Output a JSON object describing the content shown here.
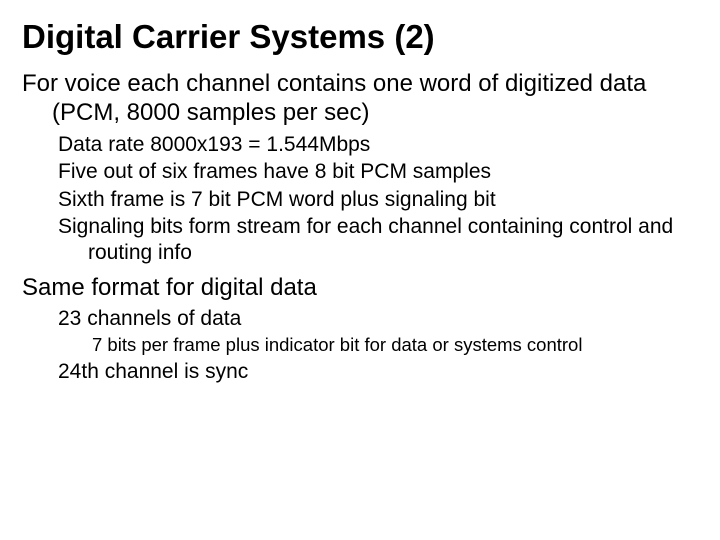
{
  "title": "Digital Carrier Systems (2)",
  "p1": "For voice each channel contains one word of digitized data (PCM, 8000 samples per sec)",
  "p1_sub": [
    "Data rate 8000x193 = 1.544Mbps",
    "Five out of six frames have 8 bit PCM samples",
    "Sixth frame is 7 bit PCM word plus signaling bit",
    "Signaling bits form stream for each channel containing control and routing info"
  ],
  "p2": "Same format for digital data",
  "p2_sub1": "23 channels of data",
  "p2_sub1_sub": "7 bits per frame plus indicator bit for data or systems control",
  "p2_sub2": "24th channel is sync"
}
